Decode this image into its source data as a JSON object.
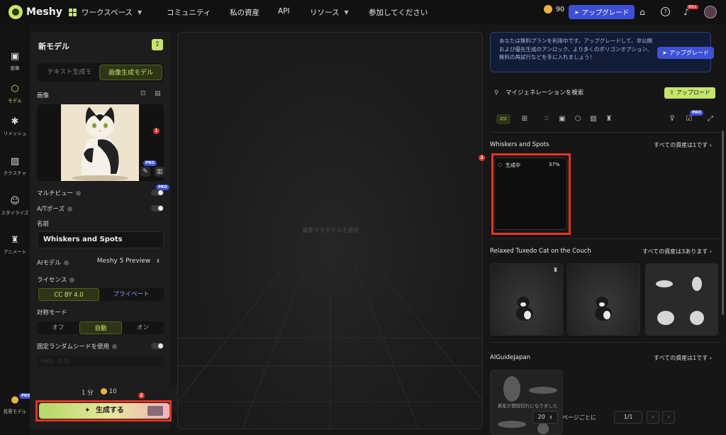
{
  "header": {
    "brand": "Meshy",
    "workspace": "ワークスペース",
    "nav": [
      "コミュニティ",
      "私の資産",
      "API",
      "リソース",
      "参加してください"
    ],
    "credits": "90",
    "upgrade": "アップグレード",
    "notification_count": "99+"
  },
  "sidebar": {
    "items": [
      {
        "label": "画像",
        "icon": "image-icon"
      },
      {
        "label": "モデル",
        "icon": "cube-icon"
      },
      {
        "label": "リメッシュ",
        "icon": "remesh-icon"
      },
      {
        "label": "テクスチャ",
        "icon": "texture-icon"
      },
      {
        "label": "スタイライズ",
        "icon": "stylize-icon"
      },
      {
        "label": "アニメート",
        "icon": "animate-icon"
      }
    ],
    "feedback": {
      "label": "投票モデル",
      "badge": "PRO"
    }
  },
  "panel": {
    "title": "新モデル",
    "tabs": [
      "テキスト生成モ",
      "画像生成モデル"
    ],
    "image_label": "画像",
    "pro": "PRO",
    "multiview_label": "マルチビュー",
    "atpose_label": "A/Tポーズ",
    "name_label": "名前",
    "name_value": "Whiskers and Spots",
    "ai_model_label": "AIモデル",
    "ai_model_value": "Meshy 5 Preview",
    "license_label": "ライセンス",
    "license_options": [
      "CC BY 4.0",
      "プライベート"
    ],
    "symmetry_label": "対称モード",
    "symmetry_options": [
      "オフ",
      "自動",
      "オン"
    ],
    "seed_label": "固定ランダムシードを使用",
    "seed_placeholder": "0001 - 5,15",
    "time": "1 分",
    "cost": "10",
    "generate": "生成する"
  },
  "viewport": {
    "hint": "編集するモデルを選択"
  },
  "right": {
    "banner": "あなたは無料プランを利用中です。アップグレードして、非公開および優先生成のアンロック、より多くのポリゴンオプション、無料の再試行などを手に入れましょう！",
    "banner_btn": "アップグレード",
    "search_placeholder": "マイジェネレーションを検索",
    "upload": "アップロード",
    "pro": "PRO",
    "groups": [
      {
        "title": "Whiskers and Spots",
        "link": "すべての資産は1です ›",
        "status": "生成中",
        "progress": "37%"
      },
      {
        "title": "Relaxed Tuxedo Cat on the Couch",
        "link": "すべての資産は3あります ›"
      },
      {
        "title": "AIGuideJapan",
        "link": "すべての資産は1です ›",
        "overlay": "資産が期限切れになりました"
      }
    ],
    "pager": {
      "per_page": "20",
      "per_page_label": "ページごとに",
      "page": "1/1"
    }
  },
  "markers": [
    "1",
    "2",
    "3"
  ],
  "colors": {
    "accent": "#c6e56b",
    "upgrade": "#3d52d8",
    "annotation": "#e8321f"
  }
}
